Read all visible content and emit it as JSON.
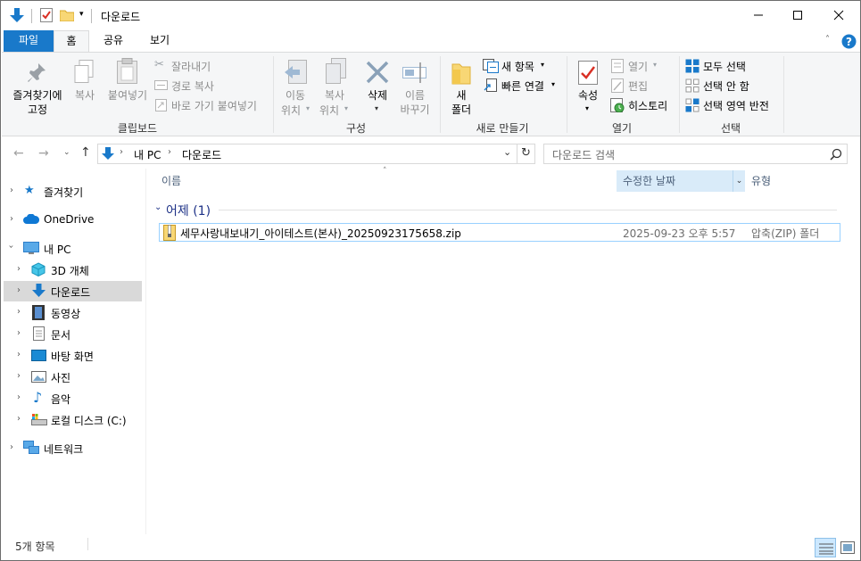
{
  "window": {
    "title": "다운로드"
  },
  "ribbon_tabs": {
    "file": "파일",
    "home": "홈",
    "share": "공유",
    "view": "보기"
  },
  "clipboard": {
    "pin_line1": "즐겨찾기에",
    "pin_line2": "고정",
    "copy": "복사",
    "paste": "붙여넣기",
    "cut": "잘라내기",
    "copy_path": "경로 복사",
    "paste_shortcut": "바로 가기 붙여넣기",
    "label": "클립보드"
  },
  "organize": {
    "move_line1": "이동",
    "move_line2": "위치",
    "copyto_line1": "복사",
    "copyto_line2": "위치",
    "delete": "삭제",
    "rename_line1": "이름",
    "rename_line2": "바꾸기",
    "label": "구성"
  },
  "new": {
    "folder_line1": "새",
    "folder_line2": "폴더",
    "new_item": "새 항목",
    "easy_access": "빠른 연결",
    "label": "새로 만들기"
  },
  "open": {
    "properties": "속성",
    "open": "열기",
    "edit": "편집",
    "history": "히스토리",
    "label": "열기"
  },
  "select": {
    "select_all": "모두 선택",
    "select_none": "선택 안 함",
    "invert": "선택 영역 반전",
    "label": "선택"
  },
  "address": {
    "crumb1": "내 PC",
    "crumb2": "다운로드",
    "search_placeholder": "다운로드 검색"
  },
  "nav": {
    "quick_access": "즐겨찾기",
    "onedrive": "OneDrive",
    "this_pc": "내 PC",
    "objects3d": "3D 개체",
    "downloads": "다운로드",
    "videos": "동영상",
    "documents": "문서",
    "desktop": "바탕 화면",
    "pictures": "사진",
    "music": "음악",
    "local_disk": "로컬 디스크 (C:)",
    "network": "네트워크"
  },
  "columns": {
    "name": "이름",
    "date": "수정한 날짜",
    "type": "유형"
  },
  "group": {
    "label": "어제 (1)"
  },
  "files": [
    {
      "name": "세무사랑내보내기_아이테스트(본사)_20250923175658.zip",
      "date": "2025-09-23 오후 5:57",
      "type": "압축(ZIP) 폴더"
    }
  ],
  "status": {
    "count": "5개 항목"
  },
  "colors": {
    "accent": "#1979ca",
    "selection": "#cce8ff",
    "folder": "#f8d775"
  }
}
